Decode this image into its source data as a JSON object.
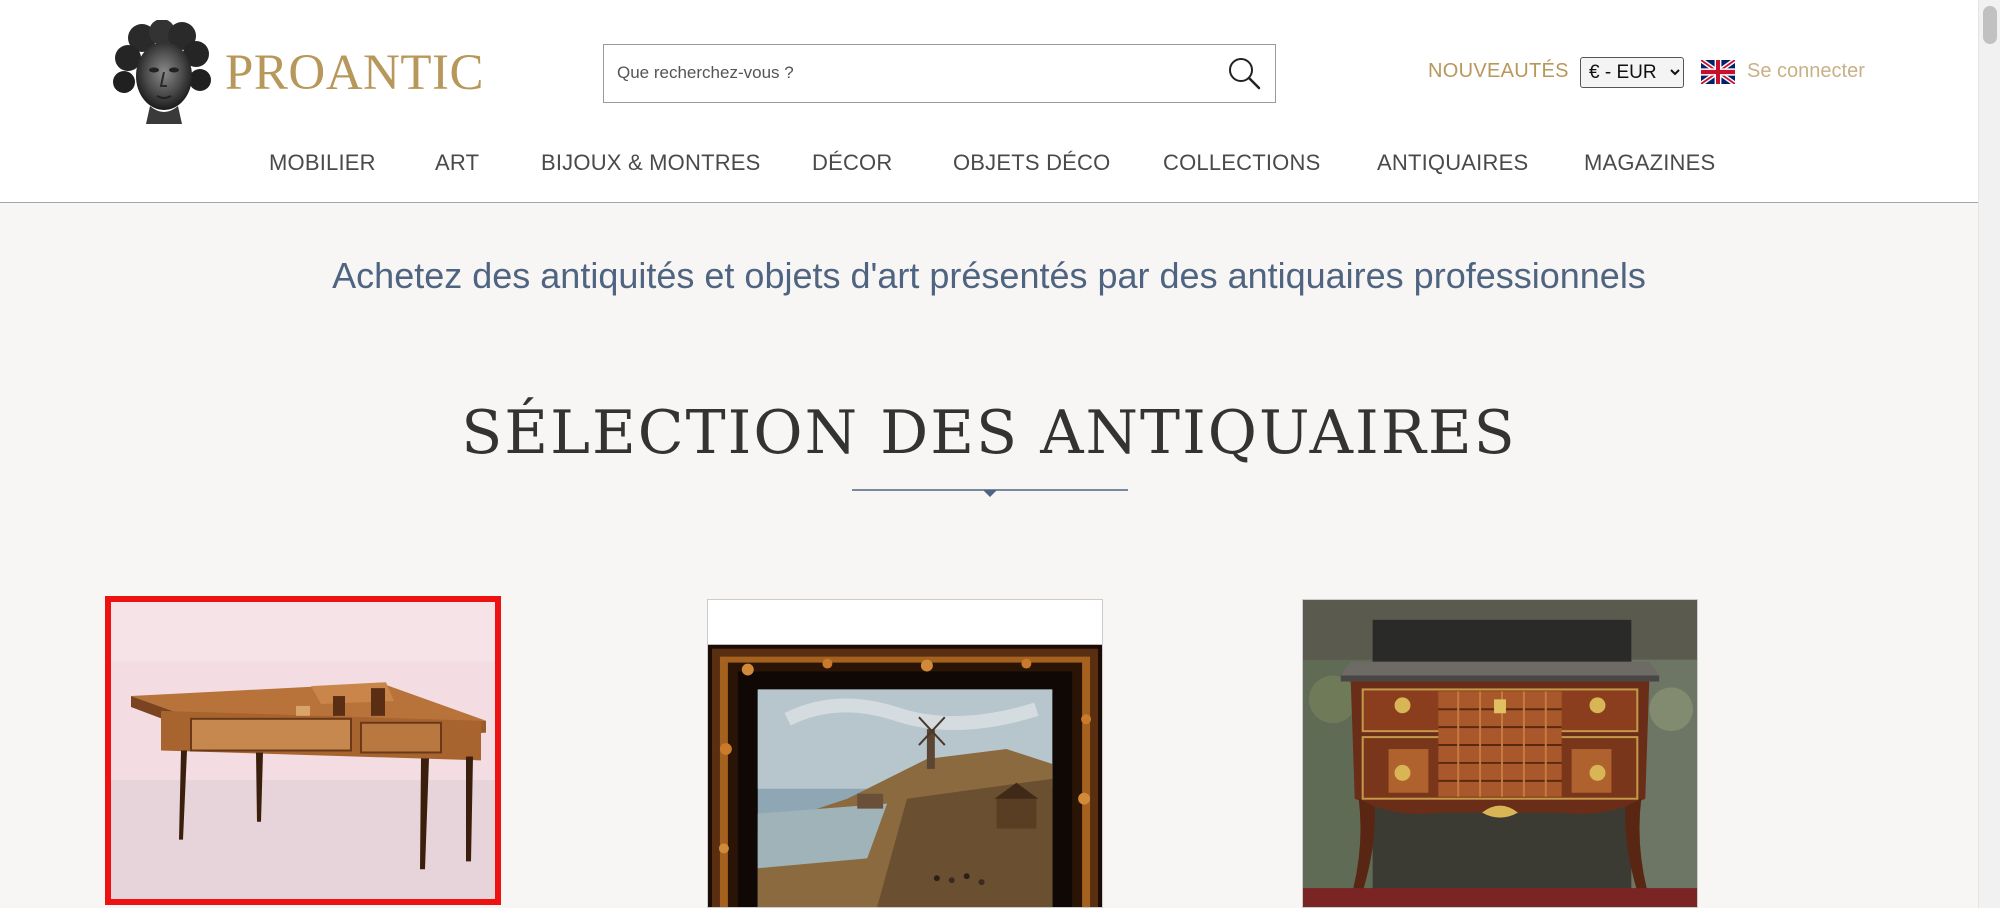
{
  "header": {
    "brand": "PROANTIC",
    "search": {
      "placeholder": "Que recherchez-vous ?"
    },
    "nouveautes": "NOUVEAUTÉS",
    "currency": {
      "selected": "€ - EUR"
    },
    "language_flag": "uk-flag-icon",
    "login": "Se connecter",
    "nav": [
      "MOBILIER",
      "ART",
      "BIJOUX & MONTRES",
      "DÉCOR",
      "OBJETS DÉCO",
      "COLLECTIONS",
      "ANTIQUAIRES",
      "MAGAZINES"
    ]
  },
  "main": {
    "tagline": "Achetez des antiquités et objets d'art présentés par des antiquaires professionnels",
    "section_title": "SÉLECTION DES ANTIQUAIRES",
    "products": [
      {
        "image": "marquetry-writing-table",
        "selected": true
      },
      {
        "image": "landscape-painting-tortoiseshell-frame",
        "selected": false
      },
      {
        "image": "louis-xv-marquetry-commode",
        "selected": false
      }
    ]
  },
  "colors": {
    "brand_gold": "#b8975a",
    "login_gold": "#c9b087",
    "tagline_blue": "#4f6480",
    "selection_red": "#ee1111",
    "background": "#f7f6f5"
  }
}
